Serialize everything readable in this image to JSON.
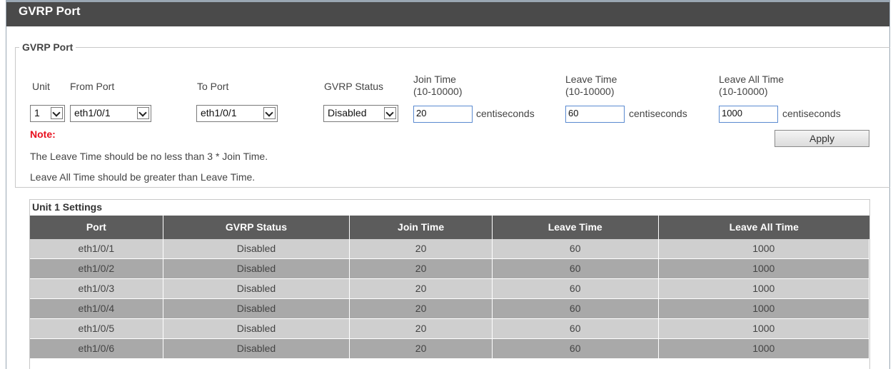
{
  "page": {
    "title": "GVRP Port"
  },
  "form": {
    "legend": "GVRP Port",
    "unit_label": "Unit",
    "from_port_label": "From Port",
    "to_port_label": "To Port",
    "gvrp_status_label": "GVRP Status",
    "join_time_label": "Join Time",
    "join_time_range": "(10-10000)",
    "leave_time_label": "Leave Time",
    "leave_time_range": "(10-10000)",
    "leave_all_time_label": "Leave All Time",
    "leave_all_time_range": "(10-10000)",
    "unit_value": "1",
    "from_port_value": "eth1/0/1",
    "to_port_value": "eth1/0/1",
    "gvrp_status_value": "Disabled",
    "join_time_value": "20",
    "leave_time_value": "60",
    "leave_all_time_value": "1000",
    "unit_text": "centiseconds",
    "apply_label": "Apply",
    "note_label": "Note:",
    "note_line1": "The Leave Time should be no less than 3 * Join Time.",
    "note_line2": "Leave All Time should be greater than Leave Time."
  },
  "table": {
    "caption": "Unit 1 Settings",
    "headers": [
      "Port",
      "GVRP Status",
      "Join Time",
      "Leave Time",
      "Leave All Time"
    ],
    "rows": [
      [
        "eth1/0/1",
        "Disabled",
        "20",
        "60",
        "1000"
      ],
      [
        "eth1/0/2",
        "Disabled",
        "20",
        "60",
        "1000"
      ],
      [
        "eth1/0/3",
        "Disabled",
        "20",
        "60",
        "1000"
      ],
      [
        "eth1/0/4",
        "Disabled",
        "20",
        "60",
        "1000"
      ],
      [
        "eth1/0/5",
        "Disabled",
        "20",
        "60",
        "1000"
      ],
      [
        "eth1/0/6",
        "Disabled",
        "20",
        "60",
        "1000"
      ]
    ]
  }
}
